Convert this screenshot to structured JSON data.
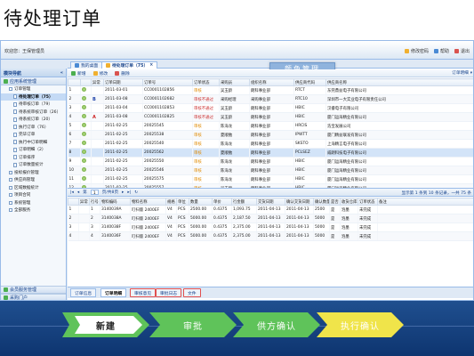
{
  "page_title": "待处理订单",
  "app": {
    "welcome": "欢迎您：王保管理员",
    "top_links": [
      {
        "icon": "edit-icon",
        "label": "修改密码"
      },
      {
        "icon": "help-icon",
        "label": "帮助"
      },
      {
        "icon": "logout-icon",
        "label": "退出"
      }
    ]
  },
  "nav": {
    "header": "模块导航",
    "top_group": "应用系统管理",
    "items": [
      {
        "label": "订单管理",
        "level": 1,
        "active": false
      },
      {
        "label": "待处理订单（75）",
        "level": 2,
        "active": true
      },
      {
        "label": "待审核订单（79）",
        "level": 2,
        "active": false
      },
      {
        "label": "待系统审核订单（26）",
        "level": 2,
        "active": false
      },
      {
        "label": "待系统订单（20）",
        "level": 2,
        "active": false
      },
      {
        "label": "执行订单（76）",
        "level": 2,
        "active": false
      },
      {
        "label": "完毕订单",
        "level": 2,
        "active": false
      },
      {
        "label": "执行中订单明细",
        "level": 2,
        "active": false
      },
      {
        "label": "订单明细（2）",
        "level": 2,
        "active": false
      },
      {
        "label": "订单排序",
        "level": 2,
        "active": false
      },
      {
        "label": "订单数量统计",
        "level": 2,
        "active": false
      },
      {
        "label": "投标报价管理",
        "level": 1,
        "active": false
      },
      {
        "label": "供应商管理",
        "level": 1,
        "active": false
      },
      {
        "label": "区域数据统计",
        "level": 1,
        "active": false
      },
      {
        "label": "项目合同",
        "level": 1,
        "active": false
      },
      {
        "label": "系统管理",
        "level": 1,
        "active": false
      },
      {
        "label": "全部服务",
        "level": 1,
        "active": false
      }
    ],
    "footer_groups": [
      "会员服务管理",
      "采购门户"
    ]
  },
  "main": {
    "tabs": [
      "我的桌面",
      "待处理订单（75）"
    ],
    "banner": "颜色管理",
    "toolbar": [
      "新增",
      "修改",
      "删除"
    ],
    "toolbar_right": "订单明细",
    "grid1": {
      "columns": [
        "",
        "",
        "异常",
        "订单日期",
        "订单号",
        "订单状态",
        "采购员",
        "组织名称",
        "供应商代码",
        "供应商名称"
      ],
      "rows": [
        {
          "flag": "",
          "date": "2011-03-01",
          "no": "CC0001102856",
          "status": "审核",
          "status_red": false,
          "buyer": "吴玉龄",
          "org": "朗科事业部",
          "code": "RTCT",
          "vendor": "东莞鼎益电子有限公司"
        },
        {
          "flag": "B",
          "date": "2011-03-08",
          "no": "CC0001102682",
          "status": "审核不通过",
          "status_red": true,
          "buyer": "采购经理",
          "org": "采购事业部",
          "code": "RTC10",
          "vendor": "深圳市一大实业电子有限责任公司"
        },
        {
          "flag": "",
          "date": "2011-03-04",
          "no": "CC0001102853",
          "status": "审核不通过",
          "status_red": true,
          "buyer": "吴玉龄",
          "org": "朗科事业部",
          "code": "HBIC",
          "vendor": "汉睿电子有限公司"
        },
        {
          "flag": "A",
          "date": "2011-03-08",
          "no": "CC0001102825",
          "status": "审核不通过",
          "status_red": true,
          "buyer": "吴玉龄",
          "org": "朗科事业部",
          "code": "HBIC",
          "vendor": "厦门运海精业有限公司"
        },
        {
          "flag": "",
          "date": "2011-02-25",
          "no": "20025545",
          "status": "审核",
          "status_red": false,
          "buyer": "陈海龙",
          "org": "朗科事业部",
          "code": "HRCIS",
          "vendor": "浩宝发展公司"
        },
        {
          "flag": "",
          "date": "2011-02-25",
          "no": "20025538",
          "status": "审核",
          "status_red": false,
          "buyer": "夏顺勉",
          "org": "朗科事业部",
          "code": "IPWTT",
          "vendor": "厦门精益联发有限公司"
        },
        {
          "flag": "",
          "date": "2011-02-25",
          "no": "20025540",
          "status": "审核",
          "status_red": false,
          "buyer": "陈海龙",
          "org": "朗科事业部",
          "code": "SKSTO",
          "vendor": "上海精言电子有限公司"
        },
        {
          "flag": "",
          "date": "2011-02-25",
          "no": "20025562",
          "status": "审核",
          "status_red": false,
          "buyer": "夏顺勉",
          "org": "朗科事业部",
          "code": "PCLSEZ",
          "vendor": "威朗科技电子有限公司"
        },
        {
          "flag": "",
          "date": "2011-02-25",
          "no": "20025550",
          "status": "审核",
          "status_red": false,
          "buyer": "陈海龙",
          "org": "朗科事业部",
          "code": "HBIC",
          "vendor": "厦门运海精业有限公司"
        },
        {
          "flag": "",
          "date": "2011-02-25",
          "no": "20025546",
          "status": "审核",
          "status_red": false,
          "buyer": "陈海龙",
          "org": "朗科事业部",
          "code": "HBIC",
          "vendor": "厦门运海精业有限公司"
        },
        {
          "flag": "",
          "date": "2011-02-25",
          "no": "20025575",
          "status": "审核",
          "status_red": false,
          "buyer": "陈海龙",
          "org": "朗科事业部",
          "code": "HBIC",
          "vendor": "厦门运海精业有限公司"
        },
        {
          "flag": "",
          "date": "2011-02-25",
          "no": "20025557",
          "status": "审核",
          "status_red": false,
          "buyer": "吴玉龄",
          "org": "朗科事业部",
          "code": "HBIC",
          "vendor": "厦门运海精业有限公司"
        }
      ]
    },
    "pager": {
      "prefix": "第",
      "page": "1",
      "suffix": "页/共8页",
      "info": "显示第 1 条到 10 条记录，一共 75 条"
    },
    "grid2": {
      "columns": [
        "",
        "异常",
        "行号",
        "物料编码",
        "物料名称",
        "规格",
        "单位",
        "数量",
        "单价",
        "行金额",
        "交货日期",
        "确认交货日期",
        "确认数量",
        "是否",
        "收货仓库",
        "订单状态",
        "备注"
      ],
      "rows": [
        [
          "1",
          "",
          "1",
          "3140039A",
          "叮扫版 2400EF",
          "V4",
          "PCS",
          "2500.00",
          "0.4375",
          "1,093.75",
          "2011-04-13",
          "2011-04-13",
          "2500",
          "是",
          "泡墨",
          "未完成",
          ""
        ],
        [
          "2",
          "",
          "2",
          "3140038A",
          "叮扫版 2400EF",
          "V4",
          "PCS",
          "5000.00",
          "0.4375",
          "2,187.50",
          "2011-04-13",
          "2011-04-13",
          "5000",
          "是",
          "泡墨",
          "未完成",
          ""
        ],
        [
          "3",
          "",
          "3",
          "3140038F",
          "叮扫版 2400EF",
          "V4",
          "PCS",
          "5000.00",
          "0.4375",
          "2,375.00",
          "2011-04-13",
          "2011-04-13",
          "5000",
          "是",
          "泡墨",
          "未完成",
          ""
        ],
        [
          "4",
          "",
          "4",
          "3140036F",
          "叮扫版 2400EF",
          "V4",
          "PCS",
          "5000.00",
          "0.4375",
          "2,375.00",
          "2011-04-13",
          "2011-04-13",
          "5000",
          "是",
          "泡墨",
          "未完成",
          ""
        ]
      ]
    },
    "bottom_tabs": [
      "订单信息",
      "订单明细",
      "审核意见",
      "审批日志",
      "文件"
    ]
  },
  "workflow": {
    "steps": [
      "新建",
      "审批",
      "供方确认",
      "执行确认"
    ],
    "colors": {
      "band": "#1f4f8f",
      "step1": "#ffffff",
      "step_green": "#5fc35a",
      "step_yellow": "#f0e44a"
    }
  }
}
